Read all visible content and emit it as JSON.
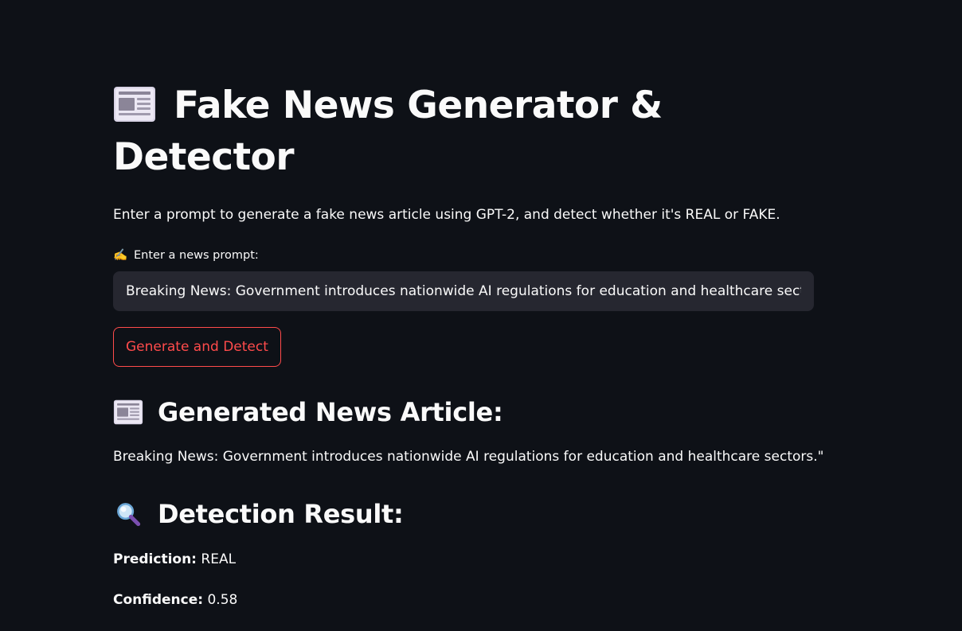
{
  "header": {
    "title": "Fake News Generator & Detector",
    "title_icon": "newspaper-icon"
  },
  "description": "Enter a prompt to generate a fake news article using GPT-2, and detect whether it's REAL or FAKE.",
  "prompt": {
    "label_emoji": "✍️",
    "label": "Enter a news prompt:",
    "value": "Breaking News: Government introduces nationwide AI regulations for education and healthcare sectors"
  },
  "action": {
    "button_label": "Generate and Detect"
  },
  "article": {
    "heading": "Generated News Article:",
    "heading_icon": "newspaper-icon",
    "text": "Breaking News: Government introduces nationwide AI regulations for education and healthcare sectors.\""
  },
  "detection": {
    "heading": "Detection Result:",
    "heading_icon": "magnifier-icon",
    "prediction_label": "Prediction:",
    "prediction_value": "REAL",
    "confidence_label": "Confidence:",
    "confidence_value": "0.58"
  },
  "colors": {
    "background": "#0e1117",
    "input_background": "#262730",
    "accent": "#ff4b4b",
    "text": "#fafafa"
  }
}
